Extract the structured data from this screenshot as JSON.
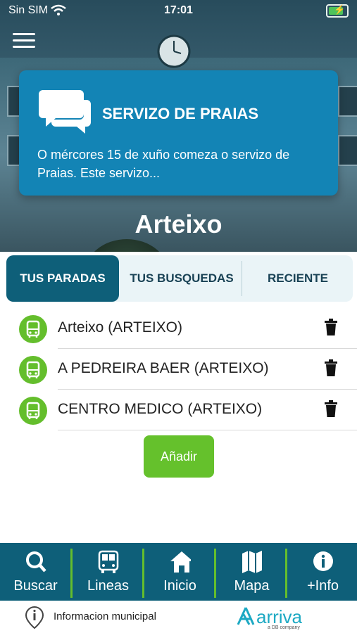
{
  "status_bar": {
    "carrier": "Sin SIM",
    "time": "17:01"
  },
  "news": {
    "title": "SERVIZO DE PRAIAS",
    "text": "O mércores 15 de xuño comeza o servizo de Praias. Este servizo..."
  },
  "branding": {
    "logo": "Arteixo"
  },
  "tabs": [
    {
      "label": "TUS PARADAS",
      "active": true
    },
    {
      "label": "TUS BUSQUEDAS",
      "active": false
    },
    {
      "label": "RECIENTE",
      "active": false
    }
  ],
  "stops": [
    {
      "name": "Arteixo (ARTEIXO)"
    },
    {
      "name": "A PEDREIRA BAER (ARTEIXO)"
    },
    {
      "name": "CENTRO MEDICO (ARTEIXO)"
    }
  ],
  "add_button": "Añadir",
  "nav": [
    {
      "label": "Buscar",
      "icon": "search-icon"
    },
    {
      "label": "Lineas",
      "icon": "bus-icon"
    },
    {
      "label": "Inicio",
      "icon": "home-icon"
    },
    {
      "label": "Mapa",
      "icon": "map-icon"
    },
    {
      "label": "+Info",
      "icon": "info-icon"
    }
  ],
  "footer": {
    "info_text": "Informacion municipal",
    "brand": "arriva",
    "brand_sub": "a DB company"
  },
  "colors": {
    "primary": "#0e5f79",
    "accent": "#64be2c",
    "card": "#1384b5"
  }
}
